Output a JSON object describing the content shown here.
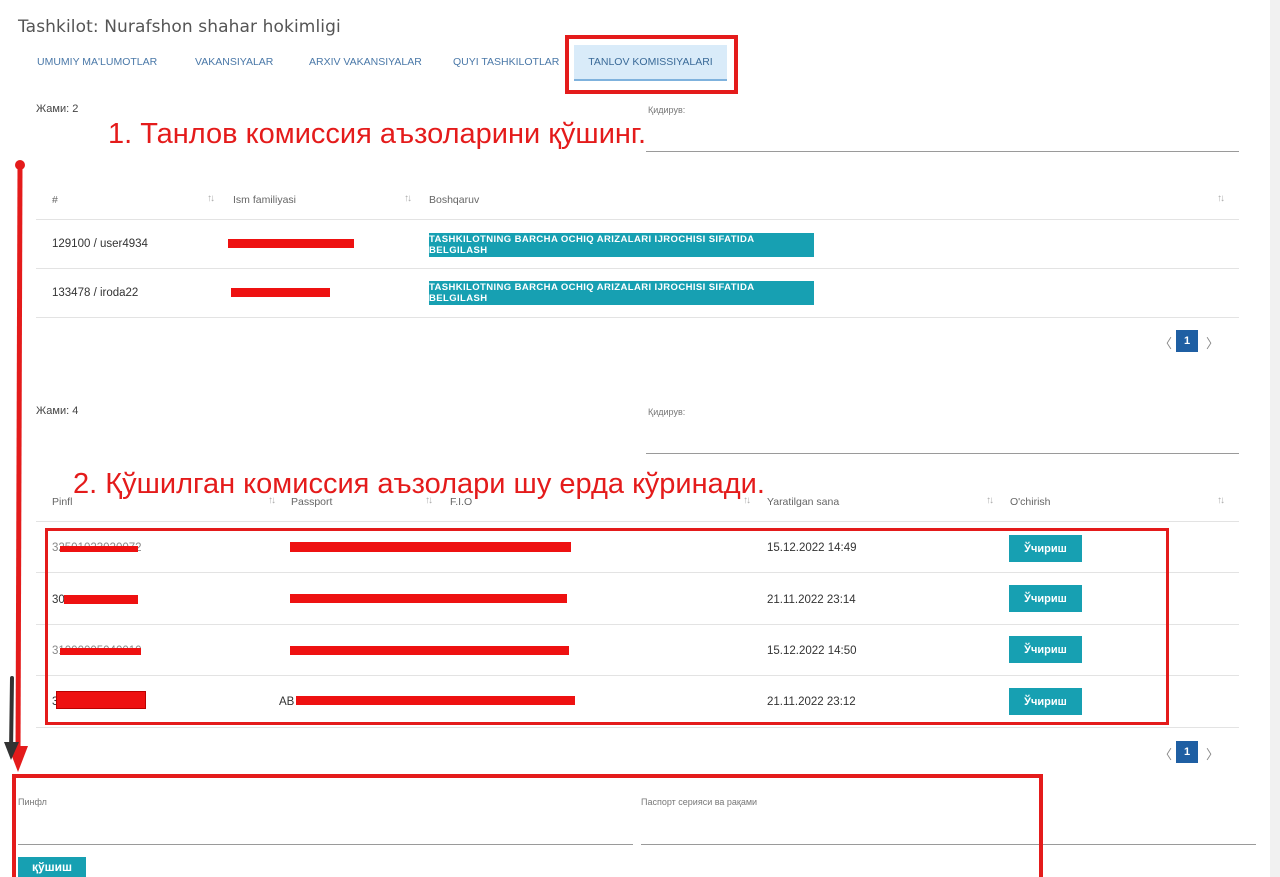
{
  "header": {
    "org_title": "Tashkilot: Nurafshon shahar hokimligi"
  },
  "tabs": [
    {
      "label": "UMUMIY MA'LUMOTLAR"
    },
    {
      "label": "VAKANSIYALAR"
    },
    {
      "label": "ARXIV VAKANSIYALAR"
    },
    {
      "label": "QUYI TASHKILOTLAR"
    },
    {
      "label": "TANLOV KOMISSIYALARI",
      "active": true
    }
  ],
  "users_section": {
    "total_label": "Жами: 2",
    "search_label": "Қидирув:",
    "columns": [
      "#",
      "Ism familiyasi",
      "Boshqaruv"
    ],
    "rows": [
      {
        "id": "129100 / user4934",
        "action": "TASHKILOTNING BARCHA OCHIQ ARIZALARI IJROCHISI SIFATIDA BELGILASH"
      },
      {
        "id": "133478 / iroda22",
        "action": "TASHKILOTNING BARCHA OCHIQ ARIZALARI IJROCHISI SIFATIDA BELGILASH"
      }
    ],
    "page": "1"
  },
  "members_section": {
    "total_label": "Жами: 4",
    "search_label": "Қидирув:",
    "columns": [
      "Pinfl",
      "Passport",
      "F.I.O",
      "Yaratilgan sana",
      "O'chirish"
    ],
    "rows": [
      {
        "pinfl": "32501023020072",
        "created": "15.12.2022 14:49",
        "delete_label": "Ўчириш"
      },
      {
        "pinfl": "30",
        "created": "21.11.2022 23:14",
        "delete_label": "Ўчириш"
      },
      {
        "pinfl": "31000005040010",
        "created": "15.12.2022 14:50",
        "delete_label": "Ўчириш"
      },
      {
        "pinfl": "31207890580013",
        "passport": "AB",
        "created": "21.11.2022 23:12",
        "delete_label": "Ўчириш"
      }
    ],
    "page": "1"
  },
  "add_form": {
    "pinfl_label": "Пинфл",
    "passport_label": "Паспорт серияси ва рақами",
    "add_button": "қўшиш"
  },
  "annotations": {
    "step1": "1. Танлов комиссия аъзоларини қўшинг.",
    "step2": "2. Қўшилган комиссия аъзолари шу ерда кўринади."
  },
  "icons": {
    "sort": "sort-arrows-icon",
    "pager_prev": "chevron-left-icon",
    "pager_next": "chevron-right-icon"
  },
  "colors": {
    "accent": "#17a0b2",
    "pager": "#1f5fa3",
    "annotation": "#e41b1b",
    "tab_active_bg": "#d9ebf9"
  }
}
